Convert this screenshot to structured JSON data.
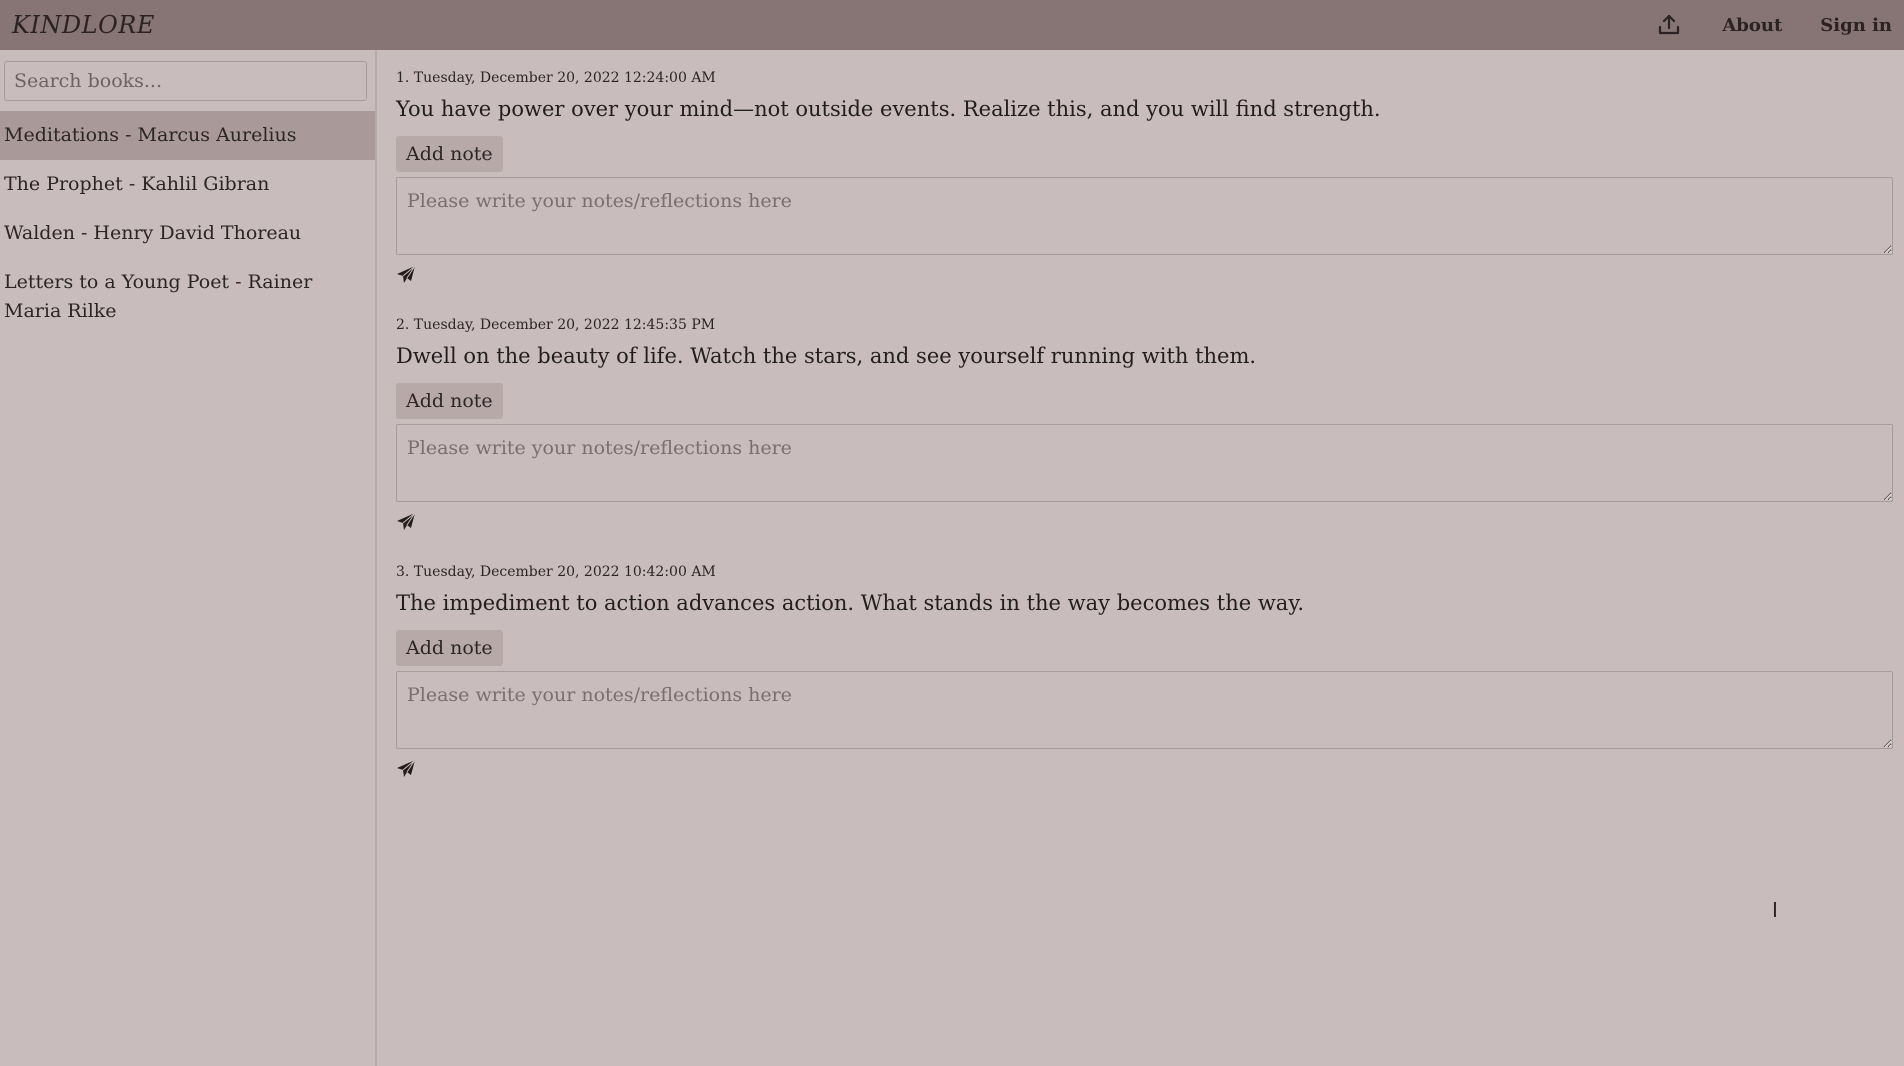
{
  "app": {
    "brand": "KINDLORE",
    "nav": {
      "upload_icon": "upload-icon",
      "about": "About",
      "sign_in": "Sign in"
    }
  },
  "sidebar": {
    "search_placeholder": "Search books...",
    "books": [
      {
        "label": "Meditations - Marcus Aurelius",
        "active": true
      },
      {
        "label": "The Prophet - Kahlil Gibran",
        "active": false
      },
      {
        "label": "Walden - Henry David Thoreau",
        "active": false
      },
      {
        "label": "Letters to a Young Poet - Rainer Maria Rilke",
        "active": false
      }
    ]
  },
  "main": {
    "add_note_label": "Add note",
    "note_placeholder": "Please write your notes/reflections here",
    "send_icon": "paper-plane-icon",
    "highlights": [
      {
        "meta": "1. Tuesday, December 20, 2022 12:24:00 AM",
        "text": "You have power over your mind—not outside events. Realize this, and you will find strength."
      },
      {
        "meta": "2. Tuesday, December 20, 2022 12:45:35 PM",
        "text": "Dwell on the beauty of life. Watch the stars, and see yourself running with them."
      },
      {
        "meta": "3. Tuesday, December 20, 2022 10:42:00 AM",
        "text": "The impediment to action advances action. What stands in the way becomes the way."
      }
    ]
  },
  "colors": {
    "topbar": "#877474",
    "background": "#c9bcbc",
    "active_item": "#a99999",
    "button": "#b8a9a9"
  }
}
